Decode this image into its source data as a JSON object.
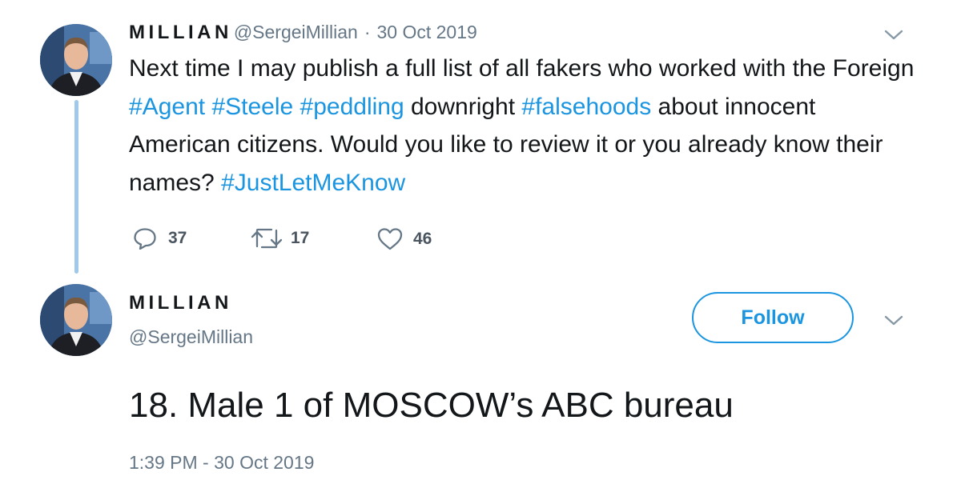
{
  "tweet1": {
    "display_name": "MILLIAN",
    "handle": "@SergeiMillian",
    "separator": "·",
    "date": "30 Oct 2019",
    "text_parts": [
      {
        "text": "Next time I may publish a full list of all fakers who worked with the Foreign ",
        "type": "text"
      },
      {
        "text": "#Agent",
        "type": "hashtag"
      },
      {
        "text": " ",
        "type": "text"
      },
      {
        "text": "#Steele",
        "type": "hashtag"
      },
      {
        "text": " ",
        "type": "text"
      },
      {
        "text": "#peddling",
        "type": "hashtag"
      },
      {
        "text": " downright ",
        "type": "text"
      },
      {
        "text": "#falsehoods",
        "type": "hashtag"
      },
      {
        "text": " about innocent American citizens. Would you like to review it or you already know their names? ",
        "type": "text"
      },
      {
        "text": "#JustLetMeKnow",
        "type": "hashtag"
      }
    ],
    "actions": {
      "replies": "37",
      "retweets": "17",
      "likes": "46"
    }
  },
  "tweet2": {
    "display_name": "MILLIAN",
    "handle": "@SergeiMillian",
    "follow_label": "Follow",
    "text": "18. Male 1 of MOSCOW’s ABC bureau",
    "timestamp": "1:39 PM - 30 Oct 2019"
  },
  "colors": {
    "hashtag": "#1b95e0",
    "muted": "#657786",
    "thread_line": "#9fc8ea"
  },
  "icons": {
    "reply": "speech-bubble",
    "retweet": "retweet-arrows",
    "like": "heart-outline",
    "menu": "chevron-down"
  }
}
